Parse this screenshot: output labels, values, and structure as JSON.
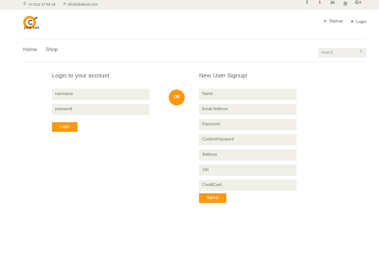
{
  "topbar": {
    "phone": "+2 0111 47 88 18",
    "email": "info@alatlcart.com",
    "social": [
      "f",
      "t",
      "in",
      "◎",
      "G+"
    ]
  },
  "logo": {
    "text": "your cart"
  },
  "header_links": {
    "signup": "Signup",
    "login": "Login"
  },
  "nav": {
    "home": "Home",
    "shop": "Shop"
  },
  "search": {
    "placeholder": "Search"
  },
  "login_form": {
    "title": "Login to your account",
    "username_placeholder": "username",
    "password_placeholder": "password",
    "button": "Login"
  },
  "or_label": "OR",
  "signup_form": {
    "title": "New User Signup!",
    "fields": [
      "Name",
      "Email Address",
      "Password",
      "ConfirmPassword",
      "Address",
      "Job",
      "CreditCard"
    ],
    "button": "Signup"
  },
  "colors": {
    "accent": "#fe980f",
    "field_bg": "#f0f0e9",
    "text": "#696763"
  }
}
